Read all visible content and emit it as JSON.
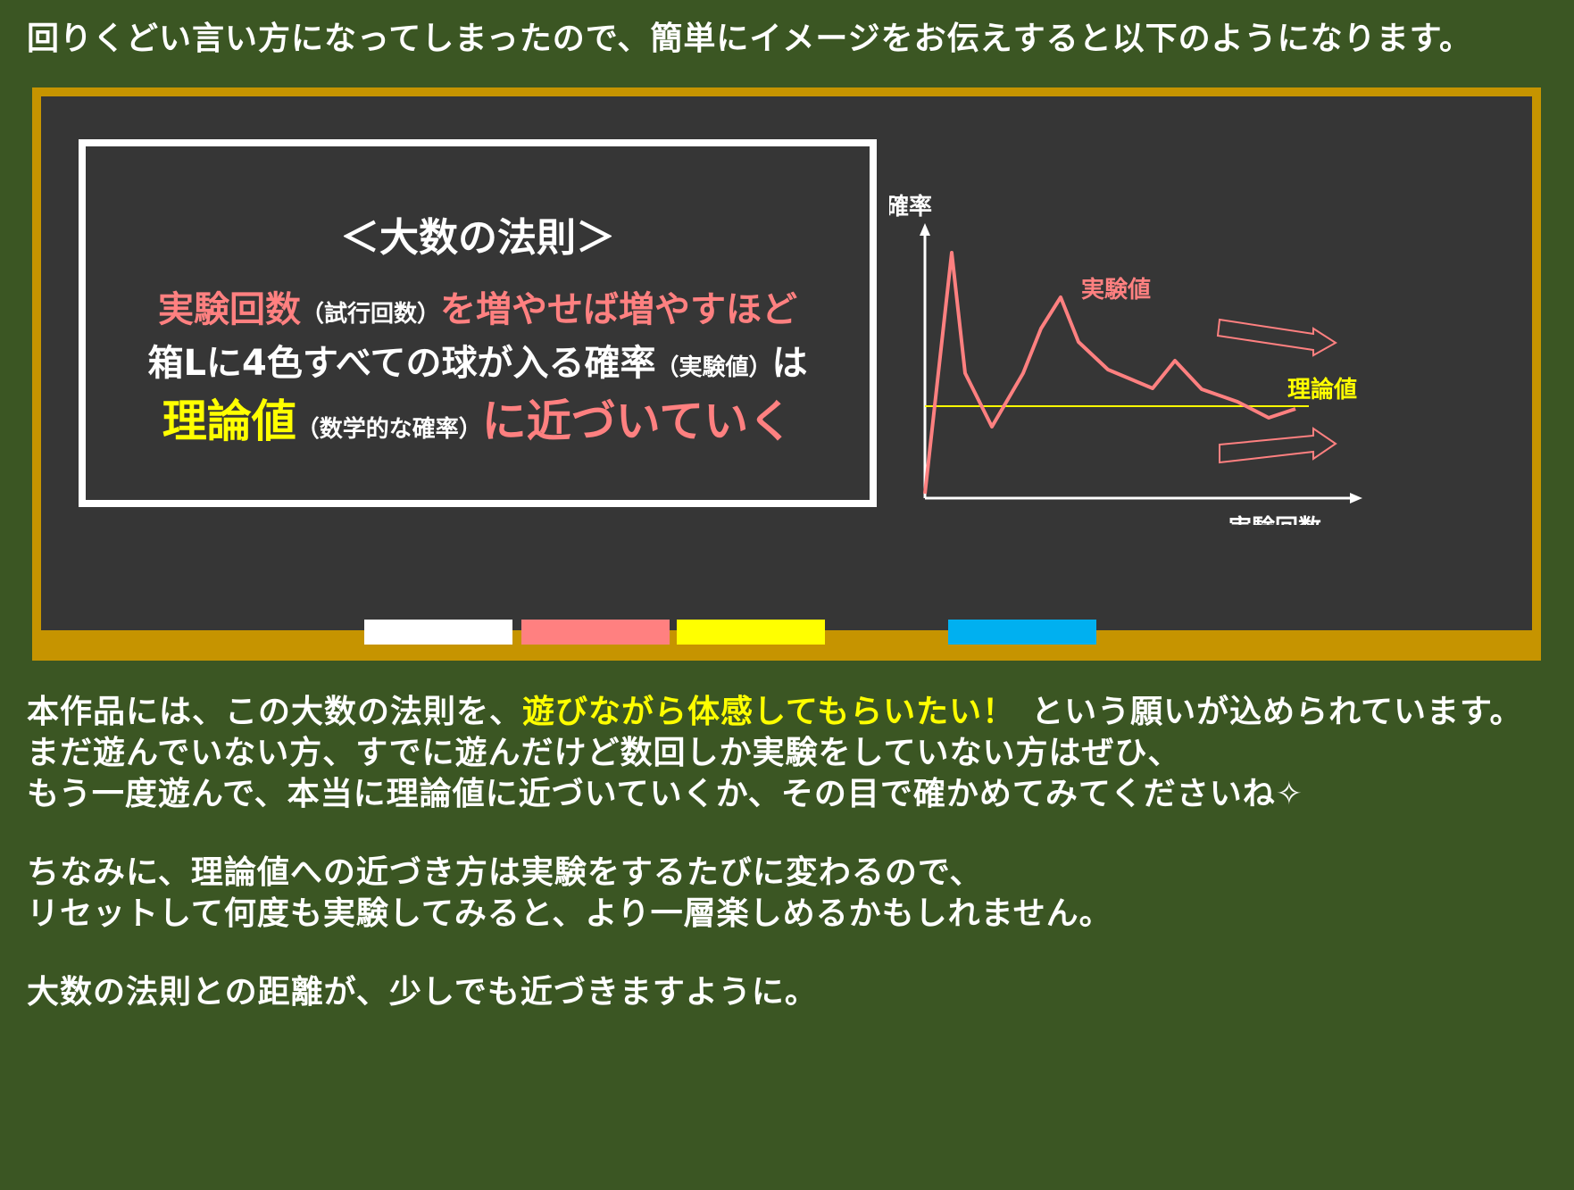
{
  "intro": "回りくどい言い方になってしまったので、簡単にイメージをお伝えすると以下のようになります。",
  "law_box": {
    "title": "＜大数の法則＞",
    "line1": {
      "part1": "実験回数",
      "part2": "（試行回数）",
      "part3": "を増やせば増やすほど"
    },
    "line2": {
      "part1": "箱Lに4色すべての球が入る確率",
      "part2": "（実験値）",
      "part3": "は"
    },
    "line3": {
      "part1": "理論値",
      "part2": "（数学的な確率）",
      "part3": "に近づいていく"
    }
  },
  "chart": {
    "y_label": "確率",
    "x_label": "実験回数",
    "experimental_label": "実験値",
    "theoretical_label": "理論値"
  },
  "chalk_colors": [
    "#ffffff",
    "#ff8080",
    "#ffff00",
    "#00b0f0"
  ],
  "colors": {
    "background": "#3b5623",
    "board": "#363636",
    "frame": "#c69400",
    "pink": "#ff8080",
    "yellow": "#ffff00"
  },
  "body": {
    "p1_before": "本作品には、この大数の法則を、",
    "p1_highlight": "遊びながら体感してもらいたい！",
    "p1_after": "という願いが込められています。",
    "p2": "まだ遊んでいない方、すでに遊んだけど数回しか実験をしていない方はぜひ、",
    "p3": "もう一度遊んで、本当に理論値に近づいていくか、その目で確かめてみてくださいね✧",
    "p4": "ちなみに、理論値への近づき方は実験をするたびに変わるので、",
    "p5": "リセットして何度も実験してみると、より一層楽しめるかもしれません。",
    "p6": "大数の法則との距離が、少しでも近づきますように。"
  }
}
